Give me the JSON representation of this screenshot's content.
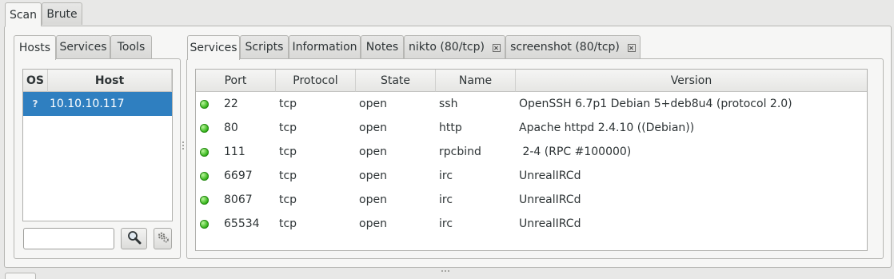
{
  "main_tabs": [
    {
      "label": "Scan",
      "active": true
    },
    {
      "label": "Brute",
      "active": false
    }
  ],
  "host_panel": {
    "tabs": [
      {
        "label": "Hosts",
        "active": true
      },
      {
        "label": "Services",
        "active": false
      },
      {
        "label": "Tools",
        "active": false
      }
    ],
    "columns": [
      "OS",
      "Host"
    ],
    "hosts": [
      {
        "os": "?",
        "host": "10.10.10.117",
        "selected": true
      }
    ],
    "filter_input_value": "",
    "search_icon": "magnifier-icon",
    "settings_icon": "gears-icon"
  },
  "detail_panel": {
    "tabs": [
      {
        "label": "Services",
        "active": true,
        "closable": false
      },
      {
        "label": "Scripts",
        "active": false,
        "closable": false
      },
      {
        "label": "Information",
        "active": false,
        "closable": false
      },
      {
        "label": "Notes",
        "active": false,
        "closable": false
      },
      {
        "label": "nikto (80/tcp)",
        "active": false,
        "closable": true
      },
      {
        "label": "screenshot (80/tcp)",
        "active": false,
        "closable": true
      }
    ],
    "columns": [
      "Port",
      "Protocol",
      "State",
      "Name",
      "Version"
    ],
    "services": [
      {
        "status": "open",
        "port": "22",
        "protocol": "tcp",
        "state": "open",
        "name": "ssh",
        "version": "OpenSSH 6.7p1 Debian 5+deb8u4 (protocol 2.0)"
      },
      {
        "status": "open",
        "port": "80",
        "protocol": "tcp",
        "state": "open",
        "name": "http",
        "version": "Apache httpd 2.4.10 ((Debian))"
      },
      {
        "status": "open",
        "port": "111",
        "protocol": "tcp",
        "state": "open",
        "name": "rpcbind",
        "version": " 2-4 (RPC #100000)"
      },
      {
        "status": "open",
        "port": "6697",
        "protocol": "tcp",
        "state": "open",
        "name": "irc",
        "version": "UnrealIRCd"
      },
      {
        "status": "open",
        "port": "8067",
        "protocol": "tcp",
        "state": "open",
        "name": "irc",
        "version": "UnrealIRCd"
      },
      {
        "status": "open",
        "port": "65534",
        "protocol": "tcp",
        "state": "open",
        "name": "irc",
        "version": "UnrealIRCd"
      }
    ]
  },
  "colors": {
    "selection": "#2f7fc0",
    "status_open": "#35b51a",
    "background": "#e8e8e7"
  }
}
